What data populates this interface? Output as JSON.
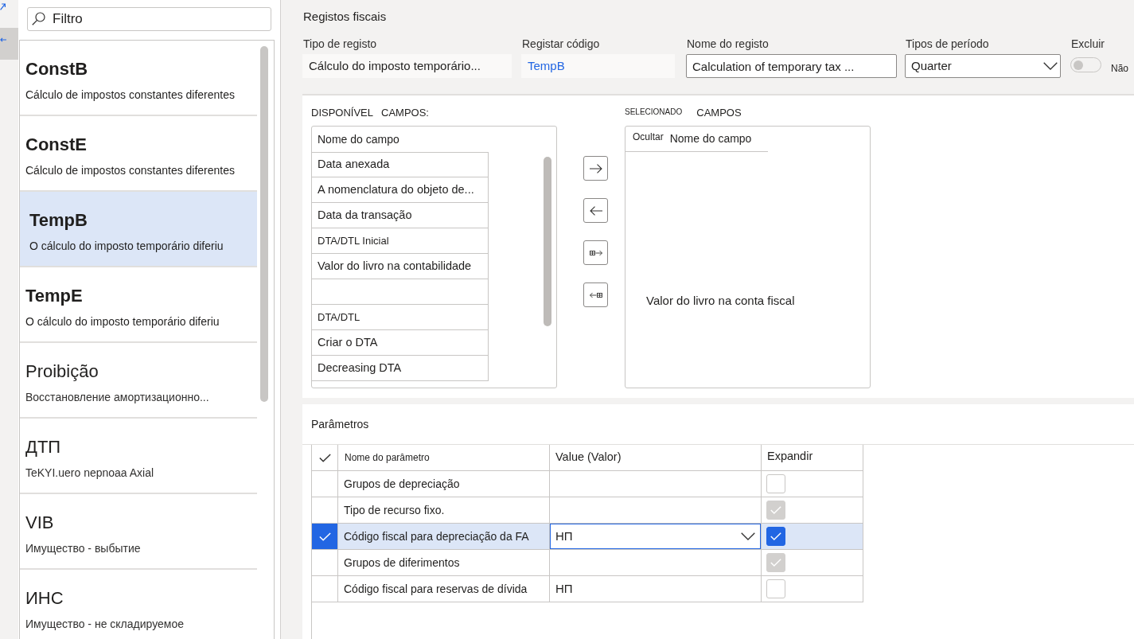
{
  "filter": {
    "placeholder": "Filtro"
  },
  "records": [
    {
      "code": "ConstB",
      "description": "Cálculo de impostos constantes diferentes",
      "kind": "bold",
      "selected": false
    },
    {
      "code": "ConstE",
      "description": "Cálculo de impostos constantes diferentes",
      "kind": "bold",
      "selected": false
    },
    {
      "code": "TempB",
      "description": "O cálculo do imposto temporário diferiu",
      "kind": "bold",
      "selected": true
    },
    {
      "code": "TempE",
      "description": "O cálculo do imposto temporário diferiu",
      "kind": "bold",
      "selected": false
    },
    {
      "code": "Proibição",
      "description": "Восстановление амортизационно...",
      "kind": "regular",
      "selected": false
    },
    {
      "code": "ДТП",
      "description": "TeKYI.uero nepnoaa Axial",
      "kind": "regular",
      "selected": false
    },
    {
      "code": "VIB",
      "description": "Имущество - выбытие",
      "kind": "regular",
      "selected": false
    },
    {
      "code": "ИНС",
      "description": "Имущество - не складируемое",
      "kind": "regular",
      "selected": false
    }
  ],
  "form": {
    "title": "Registos fiscais",
    "fields": [
      {
        "label": "Tipo de registo",
        "value": "Cálculo do imposto temporário...",
        "kind": "readonly"
      },
      {
        "label": "Registar código",
        "value": "TempB",
        "kind": "link"
      },
      {
        "label": "Nome do registo",
        "value": "Calculation of temporary tax ...",
        "kind": "input"
      },
      {
        "label": "Tipos de período",
        "value": "Quarter",
        "kind": "dropdown"
      },
      {
        "label": "Excluir",
        "value": "Não",
        "kind": "toggle",
        "on": false
      }
    ]
  },
  "available_fields": {
    "label": "DISPONÍVEL",
    "label_2": "CAMPOS:",
    "column": "Nome do campo",
    "items": [
      {
        "name": "Data anexada",
        "kind": "normal"
      },
      {
        "name": "A nomenclatura do objeto de...",
        "kind": "normal"
      },
      {
        "name": "Data da transação",
        "kind": "normal"
      },
      {
        "name": "DTA/DTL Inicial",
        "kind": "small"
      },
      {
        "name": "Valor do livro na contabilidade",
        "kind": "normal"
      },
      {
        "kind": "blank"
      },
      {
        "name": "DTA/DTL",
        "kind": "small"
      },
      {
        "name": "Criar o DTA",
        "kind": "normal"
      },
      {
        "name": "Decreasing DTA",
        "kind": "normal"
      }
    ]
  },
  "selected_fields": {
    "label": "SELECIONADO",
    "label_2": "CAMPOS",
    "columns": [
      "Ocultar",
      "Nome do campo"
    ],
    "items": [
      "Valor do livro na conta fiscal"
    ]
  },
  "parameters": {
    "title": "Parâmetros",
    "columns": [
      "Nome do parâmetro",
      "Value (Valor)",
      "Expandir"
    ],
    "rows": [
      {
        "name": "Grupos de depreciação",
        "selected": false,
        "expand": {
          "checked": false,
          "disabled": false
        }
      },
      {
        "name": "Tipo de recurso fixo.",
        "selected": false,
        "expand": {
          "checked": true,
          "disabled": true
        }
      },
      {
        "name": "Código fiscal para depreciação da FA",
        "value": "НП",
        "selected": true,
        "expand": {
          "checked": true,
          "disabled": false
        }
      },
      {
        "name": "Grupos de diferimentos",
        "selected": false,
        "expand": {
          "checked": true,
          "disabled": true
        }
      },
      {
        "name": "Código fiscal para reservas de dívida",
        "value": "НП",
        "selected": false,
        "expand": {
          "checked": false,
          "disabled": false
        }
      }
    ]
  }
}
